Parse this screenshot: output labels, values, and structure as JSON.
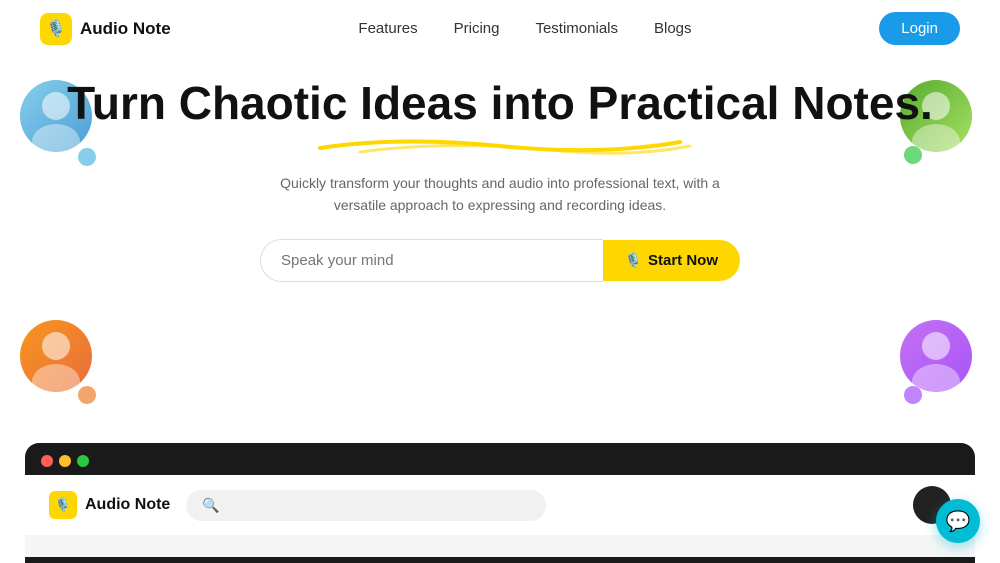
{
  "nav": {
    "logo_icon": "🎙️",
    "logo_text": "Audio Note",
    "links": [
      {
        "label": "Features",
        "id": "features"
      },
      {
        "label": "Pricing",
        "id": "pricing"
      },
      {
        "label": "Testimonials",
        "id": "testimonials"
      },
      {
        "label": "Blogs",
        "id": "blogs"
      }
    ],
    "login_label": "Login"
  },
  "hero": {
    "title": "Turn Chaotic Ideas into Practical Notes.",
    "subtitle": "Quickly transform your thoughts and audio into professional text, with a versatile approach to expressing and recording ideas.",
    "input_placeholder": "Speak your mind",
    "start_button_label": "Start Now",
    "mic_icon": "🎙️"
  },
  "app_preview": {
    "logo_icon": "🎙️",
    "logo_text": "Audio Note",
    "search_placeholder": ""
  },
  "chat": {
    "icon": "💬"
  }
}
